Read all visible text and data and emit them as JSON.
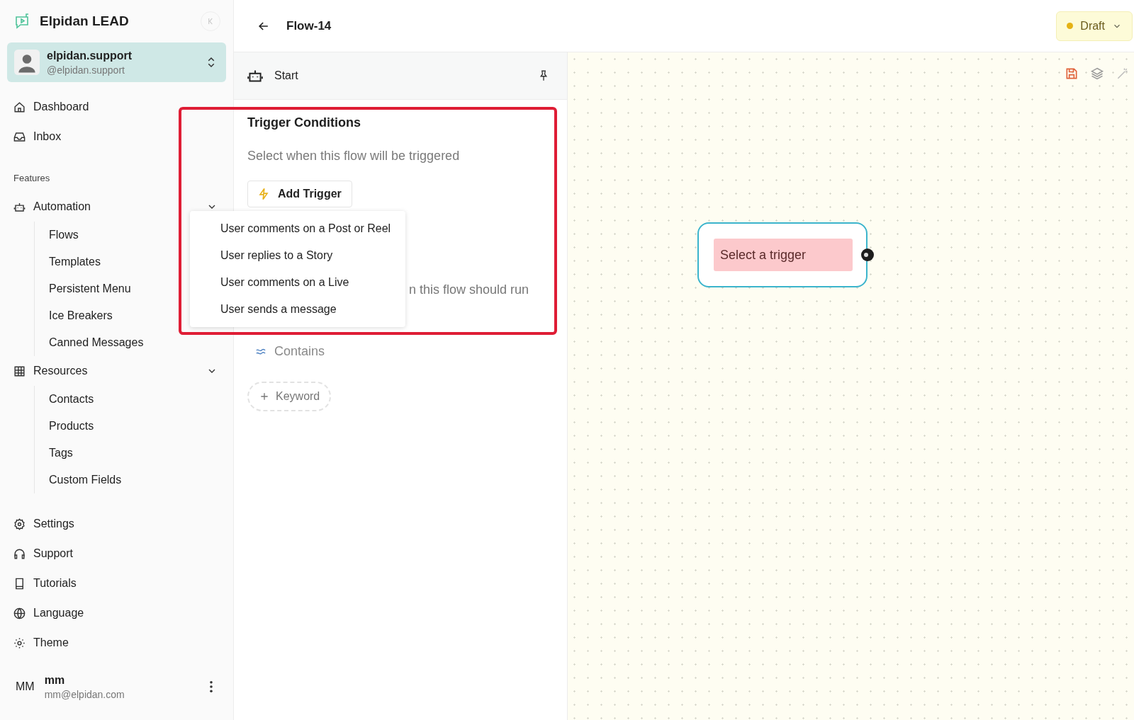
{
  "app": {
    "name": "Elpidan LEAD"
  },
  "account": {
    "name": "elpidan.support",
    "handle": "@elpidan.support"
  },
  "nav": [
    {
      "label": "Dashboard"
    },
    {
      "label": "Inbox"
    }
  ],
  "features_heading": "Features",
  "groups": [
    {
      "label": "Automation",
      "expanded": true,
      "children": [
        {
          "label": "Flows"
        },
        {
          "label": "Templates"
        },
        {
          "label": "Persistent Menu"
        },
        {
          "label": "Ice Breakers"
        },
        {
          "label": "Canned Messages"
        }
      ]
    },
    {
      "label": "Resources",
      "expanded": true,
      "children": [
        {
          "label": "Contacts"
        },
        {
          "label": "Products"
        },
        {
          "label": "Tags"
        },
        {
          "label": "Custom Fields"
        }
      ]
    }
  ],
  "bottom_nav": [
    {
      "label": "Settings"
    },
    {
      "label": "Support"
    },
    {
      "label": "Tutorials"
    },
    {
      "label": "Language"
    },
    {
      "label": "Theme"
    }
  ],
  "user": {
    "initials": "MM",
    "name": "mm",
    "email": "mm@elpidan.com"
  },
  "header": {
    "title": "Flow-14",
    "status": "Draft"
  },
  "panel": {
    "step": "Start",
    "title": "Trigger Conditions",
    "subtitle": "Select when this flow will be triggered",
    "add_button": "Add Trigger",
    "hint_fragment": "n this flow should run",
    "match_option": "Contains",
    "keyword_button": "Keyword"
  },
  "trigger_menu": [
    "User comments on a Post or Reel",
    "User replies to a Story",
    "User comments on a Live",
    "User sends a message"
  ],
  "node": {
    "label": "Select a trigger"
  }
}
